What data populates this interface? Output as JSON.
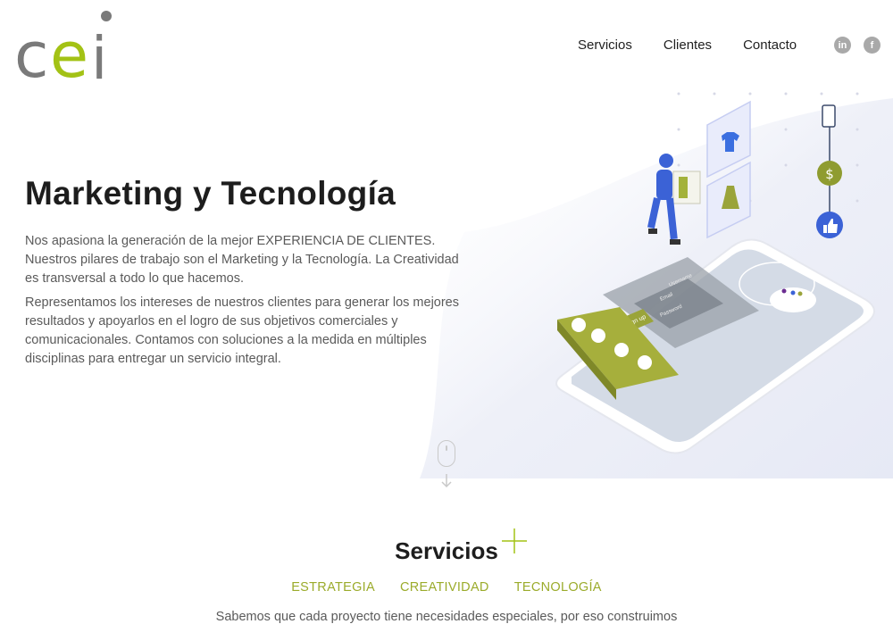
{
  "brand": {
    "logo_letters": [
      "c",
      "e",
      "i"
    ],
    "colors": {
      "gray": "#7a7a7a",
      "green": "#a3c215"
    }
  },
  "nav": {
    "items": [
      "Servicios",
      "Clientes",
      "Contacto"
    ]
  },
  "social": [
    {
      "icon": "linkedin-icon",
      "glyph": "in"
    },
    {
      "icon": "facebook-icon",
      "glyph": "f"
    }
  ],
  "hero": {
    "title": "Marketing y Tecnología",
    "p1": "Nos apasiona la generación de la mejor EXPERIENCIA DE CLIENTES. Nuestros pilares de trabajo son el Marketing y la Tecnología. La Creatividad es transversal a todo lo que hacemos.",
    "p2": "Representamos los intereses de nuestros clientes para generar los mejores resultados y apoyarlos en el logro de sus objetivos comerciales y comunicacionales. Contamos con soluciones a la medida en múltiples disciplinas para entregar un servicio integral."
  },
  "illustration": {
    "ui_text": {
      "sign_up": "Sign up",
      "field1": "Username",
      "field2": "Email",
      "field3": "Password",
      "coin": "$"
    }
  },
  "services": {
    "title": "Servicios",
    "tabs": [
      "ESTRATEGIA",
      "CREATIVIDAD",
      "TECNOLOGÍA"
    ],
    "intro": "Sabemos que cada proyecto tiene necesidades especiales, por eso construimos"
  }
}
